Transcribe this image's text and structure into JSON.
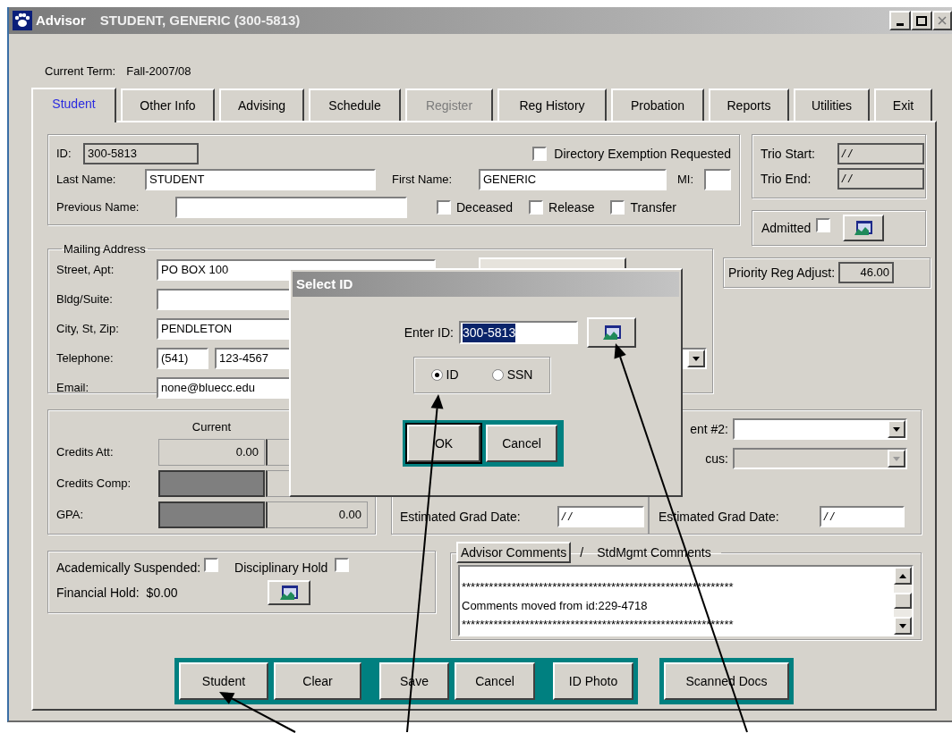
{
  "window": {
    "app": "Advisor",
    "subject": "STUDENT, GENERIC (300-5813)"
  },
  "current_term": {
    "label": "Current Term:",
    "value": "Fall-2007/08"
  },
  "tabs": [
    {
      "label": "Student",
      "selected": true,
      "disabled": false
    },
    {
      "label": "Other Info",
      "selected": false,
      "disabled": false
    },
    {
      "label": "Advising",
      "selected": false,
      "disabled": false
    },
    {
      "label": "Schedule",
      "selected": false,
      "disabled": false
    },
    {
      "label": "Register",
      "selected": false,
      "disabled": true
    },
    {
      "label": "Reg History",
      "selected": false,
      "disabled": false
    },
    {
      "label": "Probation",
      "selected": false,
      "disabled": false
    },
    {
      "label": "Reports",
      "selected": false,
      "disabled": false
    },
    {
      "label": "Utilities",
      "selected": false,
      "disabled": false
    },
    {
      "label": "Exit",
      "selected": false,
      "disabled": false
    }
  ],
  "student": {
    "id": {
      "label": "ID:",
      "value": "300-5813"
    },
    "directory_exemption": {
      "label": "Directory Exemption Requested",
      "checked": false
    },
    "last_name": {
      "label": "Last Name:",
      "value": "STUDENT"
    },
    "first_name": {
      "label": "First Name:",
      "value": "GENERIC"
    },
    "mi": {
      "label": "MI:"
    },
    "previous_name": {
      "label": "Previous Name:"
    },
    "flags": [
      {
        "label": "Deceased",
        "checked": false
      },
      {
        "label": "Release",
        "checked": false
      },
      {
        "label": "Transfer",
        "checked": false
      }
    ]
  },
  "trio": [
    {
      "label": "Trio Start:",
      "value": "/ /"
    },
    {
      "label": "Trio End:",
      "value": "/ /"
    }
  ],
  "admitted": {
    "label": "Admitted",
    "checked": false
  },
  "priority_reg_adjust": {
    "label": "Priority Reg Adjust:",
    "value": "46.00"
  },
  "mailing_address": {
    "title": "Mailing Address",
    "fields": [
      {
        "label": "Street, Apt:",
        "value": "PO BOX 100"
      },
      {
        "label": "Bldg/Suite:"
      },
      {
        "label": "City, St, Zip:",
        "value": "PENDLETON"
      },
      {
        "label": "Telephone:",
        "area_code": "(541)",
        "value": "123-4567"
      },
      {
        "label": "Email:",
        "value": "none@bluecc.edu"
      }
    ]
  },
  "credits": {
    "column_header": "Current",
    "rows": [
      {
        "label": "Credits Att:",
        "current": {
          "disabled": false,
          "value": "0.00"
        }
      },
      {
        "label": "Credits Comp:",
        "current": {
          "disabled": true
        }
      },
      {
        "label": "GPA:",
        "current": {
          "disabled": true
        },
        "column_2": "0.00"
      }
    ]
  },
  "department": {
    "dropdowns": [
      {
        "label": "ent #2:",
        "disabled": false
      },
      {
        "label": "cus:",
        "disabled": true
      }
    ],
    "grad_dates": [
      {
        "label": "Estimated Grad Date:",
        "value": "/ /"
      },
      {
        "label": "Estimated Grad Date:",
        "value": "/ /"
      }
    ]
  },
  "holds": {
    "academically_suspended": {
      "label": "Academically Suspended:",
      "checked": false
    },
    "disciplinary_hold": {
      "label": "Disciplinary Hold",
      "checked": false
    },
    "financial_hold": {
      "label": "Financial Hold:",
      "value": "$0.00"
    }
  },
  "comments": {
    "tabs": [
      {
        "label": "Advisor Comments",
        "selected": true
      },
      {
        "label": "StdMgmt Comments",
        "selected": false
      }
    ],
    "separator": "/",
    "lines": [
      "************************************************************",
      "Comments moved from id:229-4718",
      "************************************************************"
    ]
  },
  "toolbars": [
    [
      [
        "Student",
        "Clear"
      ],
      [
        "Save",
        "Cancel"
      ],
      [
        "ID Photo"
      ]
    ],
    [
      [
        "Scanned Docs"
      ]
    ]
  ],
  "dialog": {
    "title": "Select ID",
    "enter_id": {
      "label": "Enter ID:",
      "value": "300-5813",
      "text_selected": true
    },
    "options": [
      {
        "label": "ID",
        "selected": true
      },
      {
        "label": "SSN",
        "selected": false
      }
    ],
    "buttons": [
      {
        "label": "OK",
        "default": true
      },
      {
        "label": "Cancel",
        "default": false
      }
    ]
  }
}
